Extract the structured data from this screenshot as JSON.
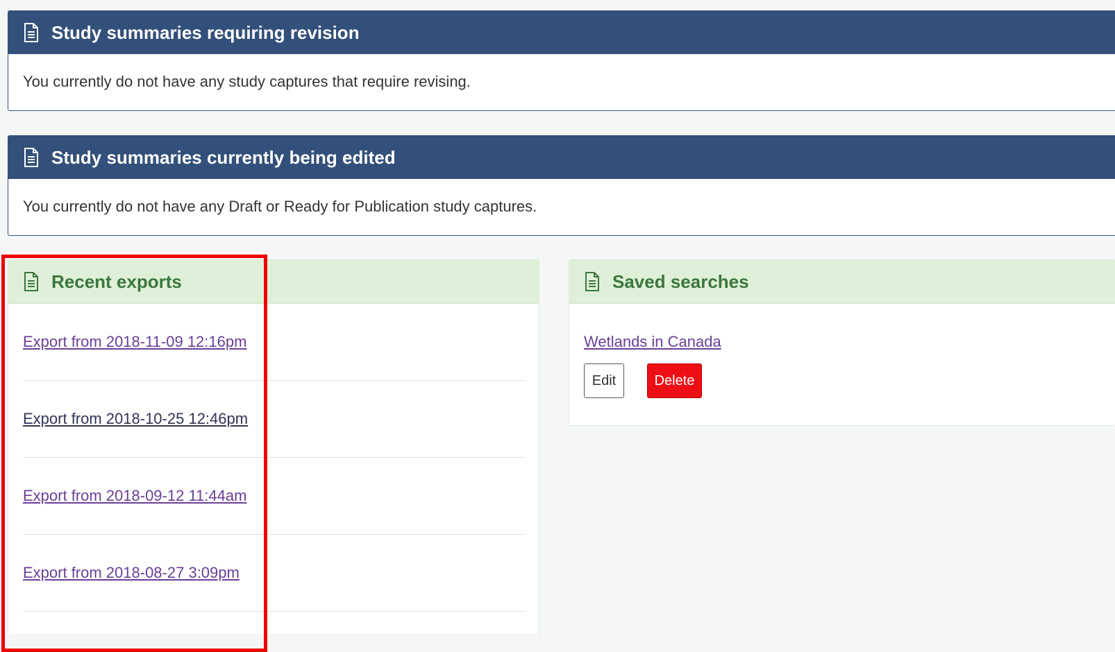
{
  "panels": {
    "revision": {
      "title": "Study summaries requiring revision",
      "message": "You currently do not have any study captures that require revising.",
      "icon": "document-icon"
    },
    "edited": {
      "title": "Study summaries currently being edited",
      "message": "You currently do not have any Draft or Ready for Publication study captures.",
      "icon": "document-icon"
    },
    "exports": {
      "title": "Recent exports",
      "icon": "document-icon",
      "items": [
        "Export from 2018-11-09 12:16pm",
        "Export from 2018-10-25 12:46pm",
        "Export from 2018-09-12 11:44am",
        "Export from 2018-08-27 3:09pm"
      ]
    },
    "saved": {
      "title": "Saved searches",
      "icon": "document-icon",
      "search_name": "Wetlands in Canada",
      "edit_label": "Edit",
      "delete_label": "Delete"
    }
  },
  "colors": {
    "header_blue": "#33507a",
    "header_green": "#dff0d8",
    "green_text": "#3c763d",
    "link_visited": "#6a3f96",
    "delete_red": "#ee0e16",
    "highlight": "#ee0000"
  }
}
